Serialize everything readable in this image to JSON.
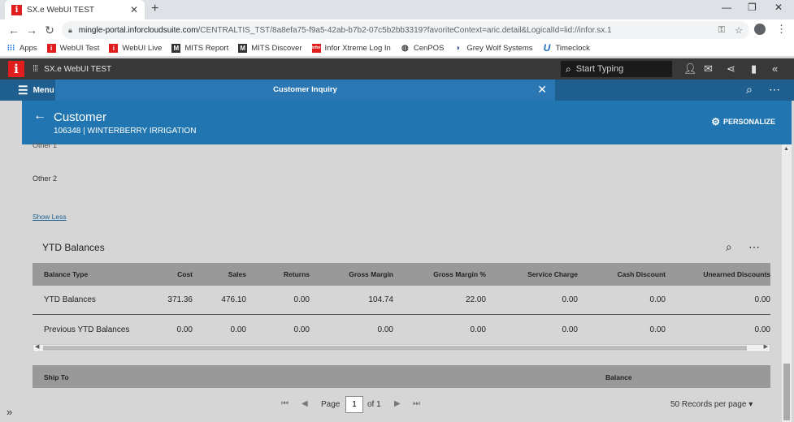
{
  "browser": {
    "tab_title": "SX.e WebUI TEST",
    "tab_favicon": "i",
    "new_tab": "+",
    "url_host": "mingle-portal.inforcloudsuite.com",
    "url_path": "/CENTRALTIS_TST/8a8efa75-f9a5-42ab-b7b2-07c5b2bb3319?favoriteContext=aric.detail&LogicalId=lid://infor.sx.1"
  },
  "bookmarks": [
    {
      "label": "Apps",
      "icon": "apps-grid-icon"
    },
    {
      "label": "WebUI Test",
      "icon": "infor-i-icon"
    },
    {
      "label": "WebUI Live",
      "icon": "infor-i-icon"
    },
    {
      "label": "MITS Report",
      "icon": "mits-icon"
    },
    {
      "label": "MITS Discover",
      "icon": "mits-icon"
    },
    {
      "label": "Infor Xtreme Log In",
      "icon": "infor-logo-icon"
    },
    {
      "label": "CenPOS",
      "icon": "globe-icon"
    },
    {
      "label": "Grey Wolf Systems",
      "icon": "wolf-icon"
    },
    {
      "label": "Timeclock",
      "icon": "u-icon"
    }
  ],
  "app_header": {
    "logo": "i",
    "app_name": "SX.e WebUI TEST",
    "search_placeholder": "Start Typing"
  },
  "context_bar": {
    "menu_label": "Menu",
    "tab_label": "Customer Inquiry"
  },
  "page_header": {
    "title": "Customer",
    "subtitle": "106348 | WINTERBERRY IRRIGATION",
    "personalize_label": "PERSONALIZE"
  },
  "fields": {
    "clipped_label": "Other 1",
    "other2_label": "Other 2",
    "show_less": "Show Less"
  },
  "ytd": {
    "title": "YTD Balances",
    "columns": [
      "Balance Type",
      "Cost",
      "Sales",
      "Returns",
      "Gross Margin",
      "Gross Margin %",
      "Service Charge",
      "Cash Discount",
      "Unearned Discounts"
    ],
    "rows": [
      [
        "YTD Balances",
        "371.36",
        "476.10",
        "0.00",
        "104.74",
        "22.00",
        "0.00",
        "0.00",
        "0.00"
      ],
      [
        "Previous YTD Balances",
        "0.00",
        "0.00",
        "0.00",
        "0.00",
        "0.00",
        "0.00",
        "0.00",
        "0.00"
      ]
    ]
  },
  "shipto": {
    "columns": [
      "Ship To",
      "Balance"
    ]
  },
  "pager": {
    "page_label": "Page",
    "page_value": "1",
    "of_label": "of 1",
    "records_per_page": "50 Records per page"
  },
  "colors": {
    "app_header_bg": "#383838",
    "context_bar_bg": "#1f5f8f",
    "active_tab_bg": "#2a77b3",
    "page_header_bg": "#2176b1",
    "grid_header_bg": "#999999",
    "content_bg": "#d6d6d6"
  }
}
